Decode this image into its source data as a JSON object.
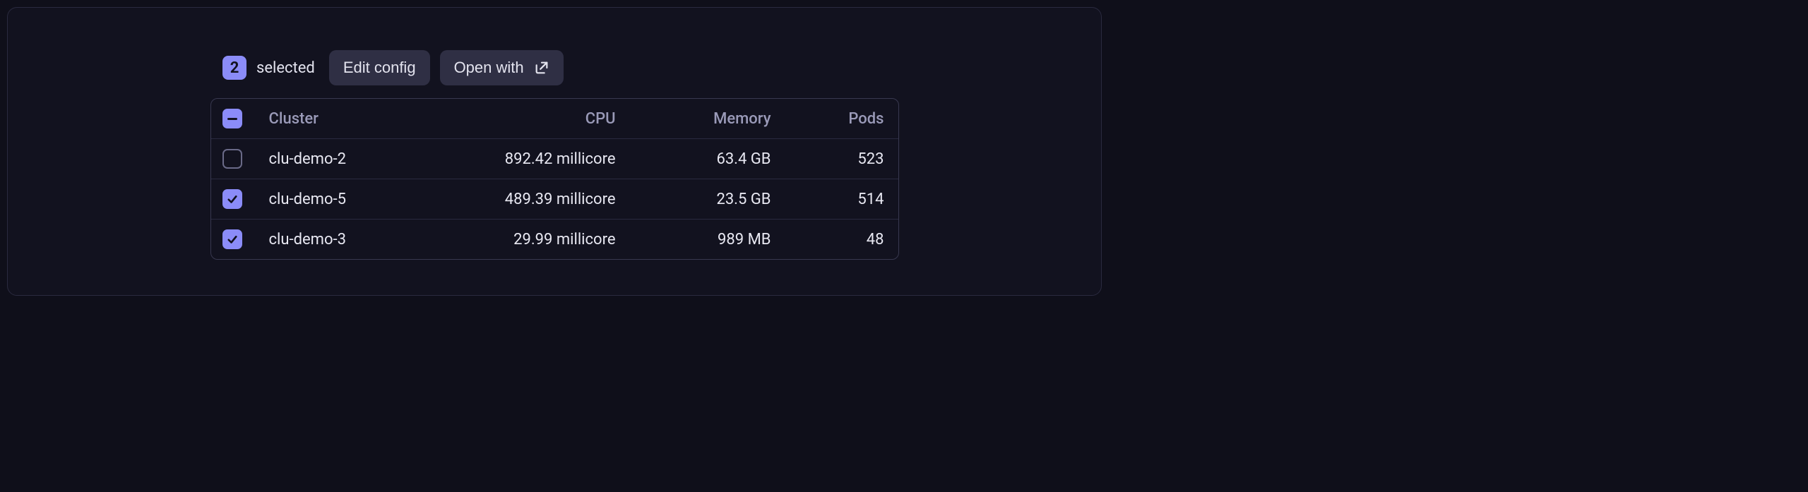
{
  "toolbar": {
    "selected_count": "2",
    "selected_label": "selected",
    "edit_config_label": "Edit config",
    "open_with_label": "Open with"
  },
  "table": {
    "headers": {
      "cluster": "Cluster",
      "cpu": "CPU",
      "memory": "Memory",
      "pods": "Pods"
    },
    "rows": [
      {
        "checked": false,
        "cluster": "clu-demo-2",
        "cpu": "892.42 millicore",
        "memory": "63.4 GB",
        "pods": "523"
      },
      {
        "checked": true,
        "cluster": "clu-demo-5",
        "cpu": "489.39 millicore",
        "memory": "23.5 GB",
        "pods": "514"
      },
      {
        "checked": true,
        "cluster": "clu-demo-3",
        "cpu": "29.99 millicore",
        "memory": "989 MB",
        "pods": "48"
      }
    ]
  }
}
